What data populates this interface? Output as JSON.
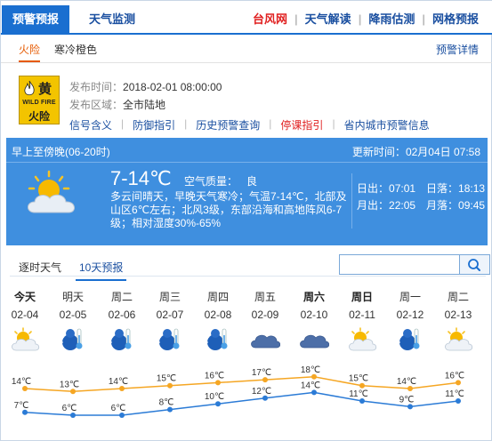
{
  "nav": {
    "active_tab": "预警预报",
    "weather_tab": "天气监测",
    "links": [
      {
        "label": "台风网",
        "red": true
      },
      {
        "label": "天气解读",
        "red": false
      },
      {
        "label": "降雨估测",
        "red": false
      },
      {
        "label": "网格预报",
        "red": false
      }
    ]
  },
  "warning_tabs": {
    "tab1": "火险",
    "tab2": "寒冷橙色",
    "detail_link": "预警详情"
  },
  "warning": {
    "badge_level": "黄",
    "badge_en": "WILD FIRE",
    "badge_cn": "火险",
    "publish_time_label": "发布时间：",
    "publish_time": "2018-02-01 08:00:00",
    "area_label": "发布区域：",
    "area": "全市陆地",
    "links": [
      {
        "label": "信号含义",
        "red": false
      },
      {
        "label": "防御指引",
        "red": false
      },
      {
        "label": "历史预警查询",
        "red": false
      },
      {
        "label": "停课指引",
        "red": true
      },
      {
        "label": "省内城市预警信息",
        "red": false
      }
    ]
  },
  "today": {
    "period": "早上至傍晚(06-20时)",
    "update_label": "更新时间：",
    "update_time": "02月04日 07:58",
    "temp_range": "7-14℃",
    "aq_label": "空气质量：",
    "aq_value": "良",
    "description": "多云间晴天，早晚天气寒冷；气温7-14℃，北部及山区6℃左右；北风3级，东部沿海和高地阵风6-7级；相对湿度30%-65%",
    "sunrise_label": "日出：",
    "sunrise": "07:01",
    "sunset_label": "日落：",
    "sunset": "18:13",
    "moonrise_label": "月出：",
    "moonrise": "22:05",
    "moonset_label": "月落：",
    "moonset": "09:45"
  },
  "forecast_tabs": {
    "hourly": "逐时天气",
    "ten_day": "10天预报"
  },
  "search": {
    "placeholder": "",
    "icon": "search-icon"
  },
  "days": [
    {
      "name": "今天",
      "date": "02-04",
      "icon": "partly-sunny-icon",
      "high": "14℃",
      "low": "7℃",
      "bold": true
    },
    {
      "name": "明天",
      "date": "02-05",
      "icon": "cold-thermometer-icon",
      "high": "13℃",
      "low": "6℃",
      "bold": false
    },
    {
      "name": "周二",
      "date": "02-06",
      "icon": "cold-thermometer-icon",
      "high": "14℃",
      "low": "6℃",
      "bold": false
    },
    {
      "name": "周三",
      "date": "02-07",
      "icon": "cold-thermometer-icon",
      "high": "15℃",
      "low": "8℃",
      "bold": false
    },
    {
      "name": "周四",
      "date": "02-08",
      "icon": "cold-thermometer-icon",
      "high": "16℃",
      "low": "10℃",
      "bold": false
    },
    {
      "name": "周五",
      "date": "02-09",
      "icon": "cloud-icon",
      "high": "17℃",
      "low": "12℃",
      "bold": false
    },
    {
      "name": "周六",
      "date": "02-10",
      "icon": "cloud-icon",
      "high": "18℃",
      "low": "14℃",
      "bold": true
    },
    {
      "name": "周日",
      "date": "02-11",
      "icon": "partly-sunny-icon",
      "high": "15℃",
      "low": "11℃",
      "bold": true
    },
    {
      "name": "周一",
      "date": "02-12",
      "icon": "cold-thermometer-icon",
      "high": "14℃",
      "low": "9℃",
      "bold": false
    },
    {
      "name": "周二",
      "date": "02-13",
      "icon": "partly-sunny-icon",
      "high": "16℃",
      "low": "11℃",
      "bold": false
    }
  ],
  "temperature_chart": {
    "high_values": [
      14,
      13,
      14,
      15,
      16,
      17,
      18,
      15,
      14,
      16
    ],
    "low_values": [
      7,
      6,
      6,
      8,
      10,
      12,
      14,
      11,
      9,
      11
    ]
  },
  "colors": {
    "brand_blue": "#1a6fd0",
    "panel_blue": "#3f8fdf",
    "warning_orange": "#e65a00",
    "high_line": "#f5a623",
    "low_line": "#2b7bd6"
  }
}
